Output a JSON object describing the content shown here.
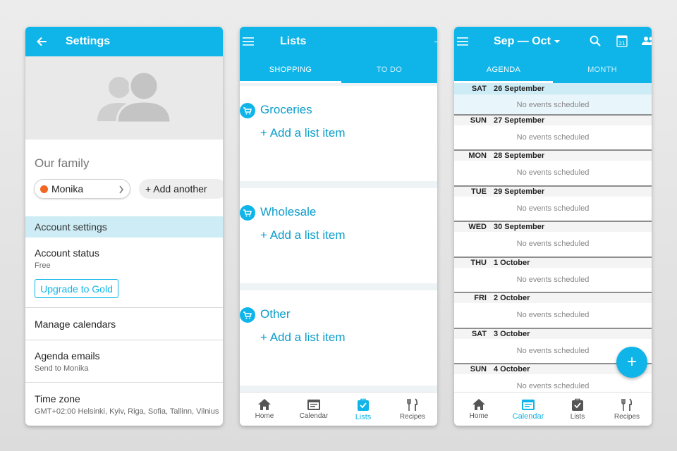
{
  "colors": {
    "brand": "#0fb5e8",
    "accent_text": "#0b9dca",
    "highlight": "#cdecf6",
    "member_dot": "#f26522"
  },
  "settings": {
    "title": "Settings",
    "family_label": "Our family",
    "member_name": "Monika",
    "add_another": "+ Add another",
    "account_settings": "Account settings",
    "account_status": "Account status",
    "account_status_value": "Free",
    "upgrade": "Upgrade to Gold",
    "manage_calendars": "Manage calendars",
    "agenda_emails": "Agenda emails",
    "agenda_emails_sub": "Send to Monika",
    "time_zone": "Time zone",
    "time_zone_value": "GMT+02:00 Helsinki, Kyiv, Riga, Sofia, Tallinn, Vilnius"
  },
  "lists": {
    "title": "Lists",
    "tabs": [
      "SHOPPING",
      "TO DO"
    ],
    "items": [
      {
        "name": "Groceries",
        "add": "+ Add a list item"
      },
      {
        "name": "Wholesale",
        "add": "+ Add a list item"
      },
      {
        "name": "Other",
        "add": "+ Add a list item"
      }
    ]
  },
  "calendar": {
    "title": "Sep — Oct",
    "tabs": [
      "AGENDA",
      "MONTH"
    ],
    "cal_badge": "21",
    "no_events": "No events scheduled",
    "days": [
      {
        "dow": "SAT",
        "date": "26 September"
      },
      {
        "dow": "SUN",
        "date": "27 September"
      },
      {
        "dow": "MON",
        "date": "28 September"
      },
      {
        "dow": "TUE",
        "date": "29 September"
      },
      {
        "dow": "WED",
        "date": "30 September"
      },
      {
        "dow": "THU",
        "date": "1 October"
      },
      {
        "dow": "FRI",
        "date": "2 October"
      },
      {
        "dow": "SAT",
        "date": "3 October"
      },
      {
        "dow": "SUN",
        "date": "4 October"
      }
    ],
    "fab": "+"
  },
  "nav": {
    "home": "Home",
    "calendar": "Calendar",
    "lists": "Lists",
    "recipes": "Recipes"
  }
}
